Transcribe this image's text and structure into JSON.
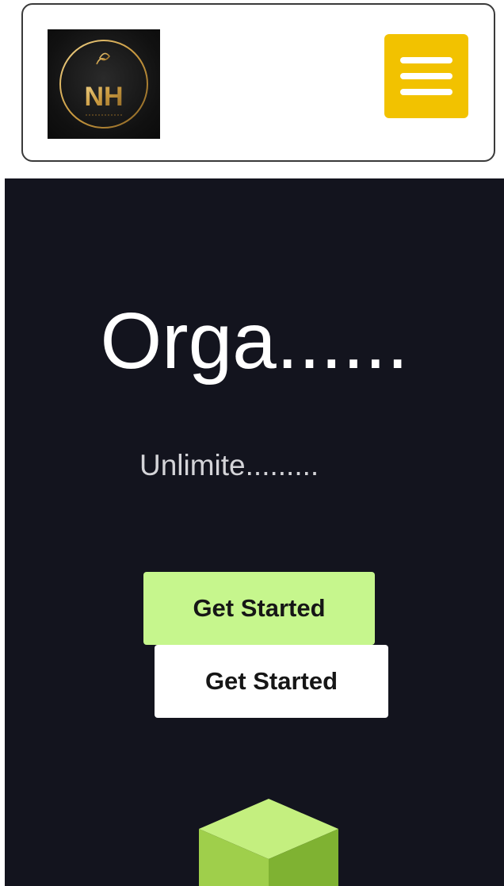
{
  "header": {
    "logo_text": "NH",
    "menu_icon": "hamburger-menu-icon",
    "menu_color": "#f2c200"
  },
  "hero": {
    "title": "Orga......",
    "subtitle": "Unlimite.........",
    "primary_button_label": "Get Started",
    "secondary_button_label": "Get Started",
    "background_color": "#13141e",
    "accent_color": "#c6f68d",
    "decoration": "cube-graphic"
  }
}
